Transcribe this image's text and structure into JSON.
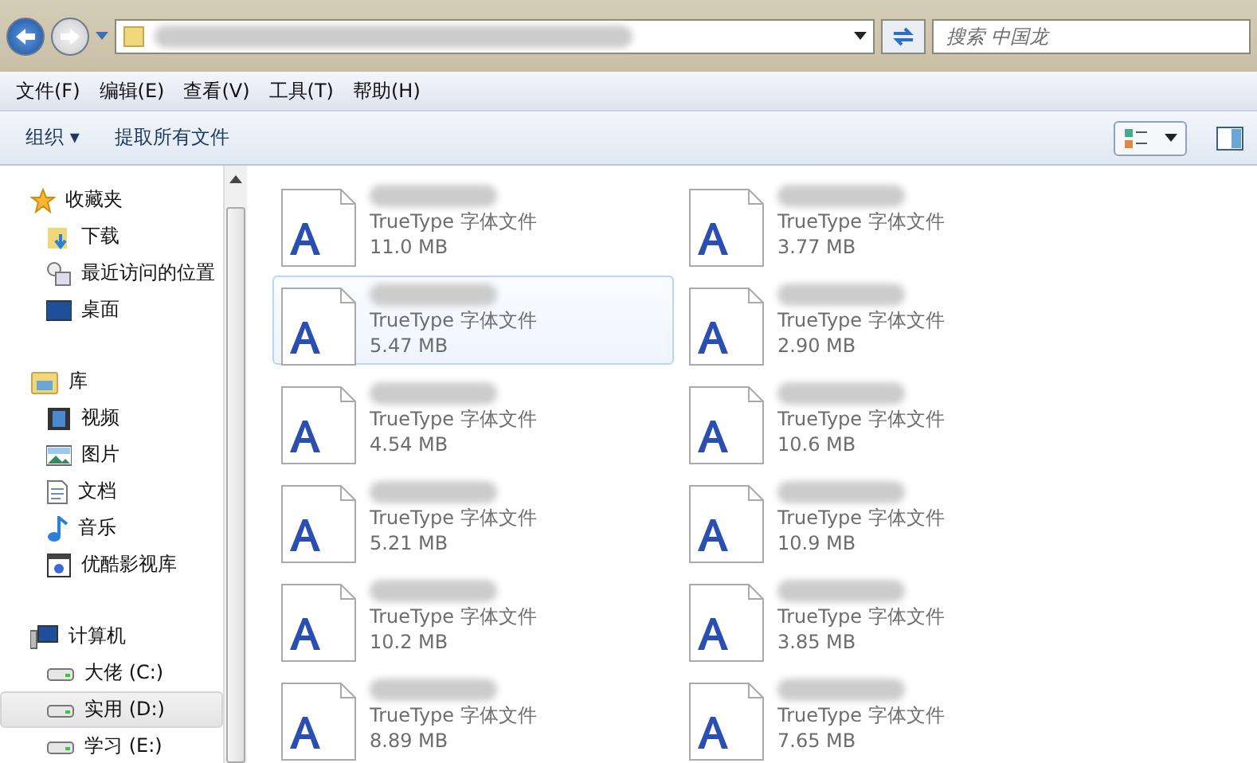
{
  "search": {
    "placeholder": "搜索 中国龙"
  },
  "menu": [
    "文件(F)",
    "编辑(E)",
    "查看(V)",
    "工具(T)",
    "帮助(H)"
  ],
  "toolbar": [
    "组织 ▾",
    "提取所有文件"
  ],
  "sidebar": [
    {
      "label": "收藏夹",
      "kind": "star",
      "children": [
        {
          "label": "下载",
          "kind": "download",
          "selected": false
        },
        {
          "label": "最近访问的位置",
          "kind": "recent",
          "selected": false
        },
        {
          "label": "桌面",
          "kind": "desktop",
          "selected": false
        }
      ]
    },
    {
      "label": "库",
      "kind": "library",
      "children": [
        {
          "label": "视频",
          "kind": "video",
          "selected": false
        },
        {
          "label": "图片",
          "kind": "image",
          "selected": false
        },
        {
          "label": "文档",
          "kind": "doc",
          "selected": false
        },
        {
          "label": "音乐",
          "kind": "music",
          "selected": false
        },
        {
          "label": "优酷影视库",
          "kind": "media",
          "selected": false
        }
      ]
    },
    {
      "label": "计算机",
      "kind": "computer",
      "children": [
        {
          "label": "大佬 (C:)",
          "kind": "drive",
          "selected": false
        },
        {
          "label": "实用 (D:)",
          "kind": "drive",
          "selected": true
        },
        {
          "label": "学习 (E:)",
          "kind": "drive",
          "selected": false
        }
      ]
    }
  ],
  "files": [
    {
      "type": "TrueType 字体文件",
      "size": "11.0 MB",
      "selected": false
    },
    {
      "type": "TrueType 字体文件",
      "size": "3.77 MB",
      "selected": false
    },
    {
      "type": "TrueType 字体文件",
      "size": "5.47 MB",
      "selected": true
    },
    {
      "type": "TrueType 字体文件",
      "size": "2.90 MB",
      "selected": false
    },
    {
      "type": "TrueType 字体文件",
      "size": "4.54 MB",
      "selected": false
    },
    {
      "type": "TrueType 字体文件",
      "size": "10.6 MB",
      "selected": false
    },
    {
      "type": "TrueType 字体文件",
      "size": "5.21 MB",
      "selected": false
    },
    {
      "type": "TrueType 字体文件",
      "size": "10.9 MB",
      "selected": false
    },
    {
      "type": "TrueType 字体文件",
      "size": "10.2 MB",
      "selected": false
    },
    {
      "type": "TrueType 字体文件",
      "size": "3.85 MB",
      "selected": false
    },
    {
      "type": "TrueType 字体文件",
      "size": "8.89 MB",
      "selected": false
    },
    {
      "type": "TrueType 字体文件",
      "size": "7.65 MB",
      "selected": false
    }
  ]
}
